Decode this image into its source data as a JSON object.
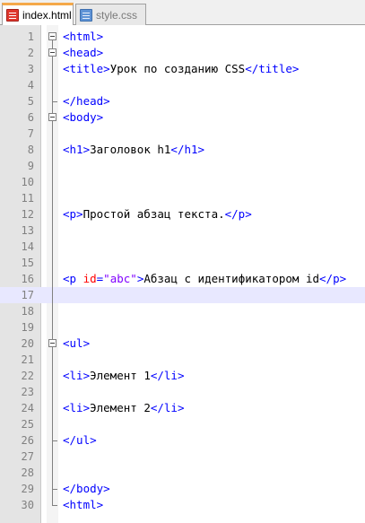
{
  "tabs": [
    {
      "label": "index.html",
      "icon": "html-file-icon",
      "active": true
    },
    {
      "label": "style.css",
      "icon": "css-file-icon",
      "active": false
    }
  ],
  "colors": {
    "tag": "#0000ff",
    "attribute": "#ff0000",
    "attribute_value": "#8000ff",
    "text": "#000000",
    "active_tab_accent": "#f5a94a",
    "current_line": "#e8e8ff"
  },
  "lines": [
    {
      "n": "1",
      "html": "<span class=\"tag\">&lt;html&gt;</span>"
    },
    {
      "n": "2",
      "html": "<span class=\"tag\">&lt;head&gt;</span>"
    },
    {
      "n": "3",
      "html": "<span class=\"tag\">&lt;title&gt;</span>Урок по созданию CSS<span class=\"tag\">&lt;/title&gt;</span>"
    },
    {
      "n": "4",
      "html": ""
    },
    {
      "n": "5",
      "html": "<span class=\"tag\">&lt;/head&gt;</span>"
    },
    {
      "n": "6",
      "html": "<span class=\"tag\">&lt;body&gt;</span>"
    },
    {
      "n": "7",
      "html": ""
    },
    {
      "n": "8",
      "html": "<span class=\"tag\">&lt;h1&gt;</span>Заголовок h1<span class=\"tag\">&lt;/h1&gt;</span>"
    },
    {
      "n": "9",
      "html": ""
    },
    {
      "n": "10",
      "html": ""
    },
    {
      "n": "11",
      "html": ""
    },
    {
      "n": "12",
      "html": "<span class=\"tag\">&lt;p&gt;</span>Простой абзац текста.<span class=\"tag\">&lt;/p&gt;</span>"
    },
    {
      "n": "13",
      "html": ""
    },
    {
      "n": "14",
      "html": ""
    },
    {
      "n": "15",
      "html": ""
    },
    {
      "n": "16",
      "html": "<span class=\"tag\">&lt;p </span><span class=\"attr\">id</span><span class=\"tag\">=</span><span class=\"val\">\"abc\"</span><span class=\"tag\">&gt;</span>Абзац с идентификатором id<span class=\"tag\">&lt;/p&gt;</span>"
    },
    {
      "n": "17",
      "html": "",
      "current": true
    },
    {
      "n": "18",
      "html": ""
    },
    {
      "n": "19",
      "html": ""
    },
    {
      "n": "20",
      "html": "<span class=\"tag\">&lt;ul&gt;</span>"
    },
    {
      "n": "21",
      "html": ""
    },
    {
      "n": "22",
      "html": "<span class=\"tag\">&lt;li&gt;</span>Элемент 1<span class=\"tag\">&lt;/li&gt;</span>"
    },
    {
      "n": "23",
      "html": ""
    },
    {
      "n": "24",
      "html": "<span class=\"tag\">&lt;li&gt;</span>Элемент 2<span class=\"tag\">&lt;/li&gt;</span>"
    },
    {
      "n": "25",
      "html": ""
    },
    {
      "n": "26",
      "html": "<span class=\"tag\">&lt;/ul&gt;</span>"
    },
    {
      "n": "27",
      "html": ""
    },
    {
      "n": "28",
      "html": ""
    },
    {
      "n": "29",
      "html": "<span class=\"tag\">&lt;/body&gt;</span>"
    },
    {
      "n": "30",
      "html": "<span class=\"tag\">&lt;html&gt;</span>"
    }
  ]
}
